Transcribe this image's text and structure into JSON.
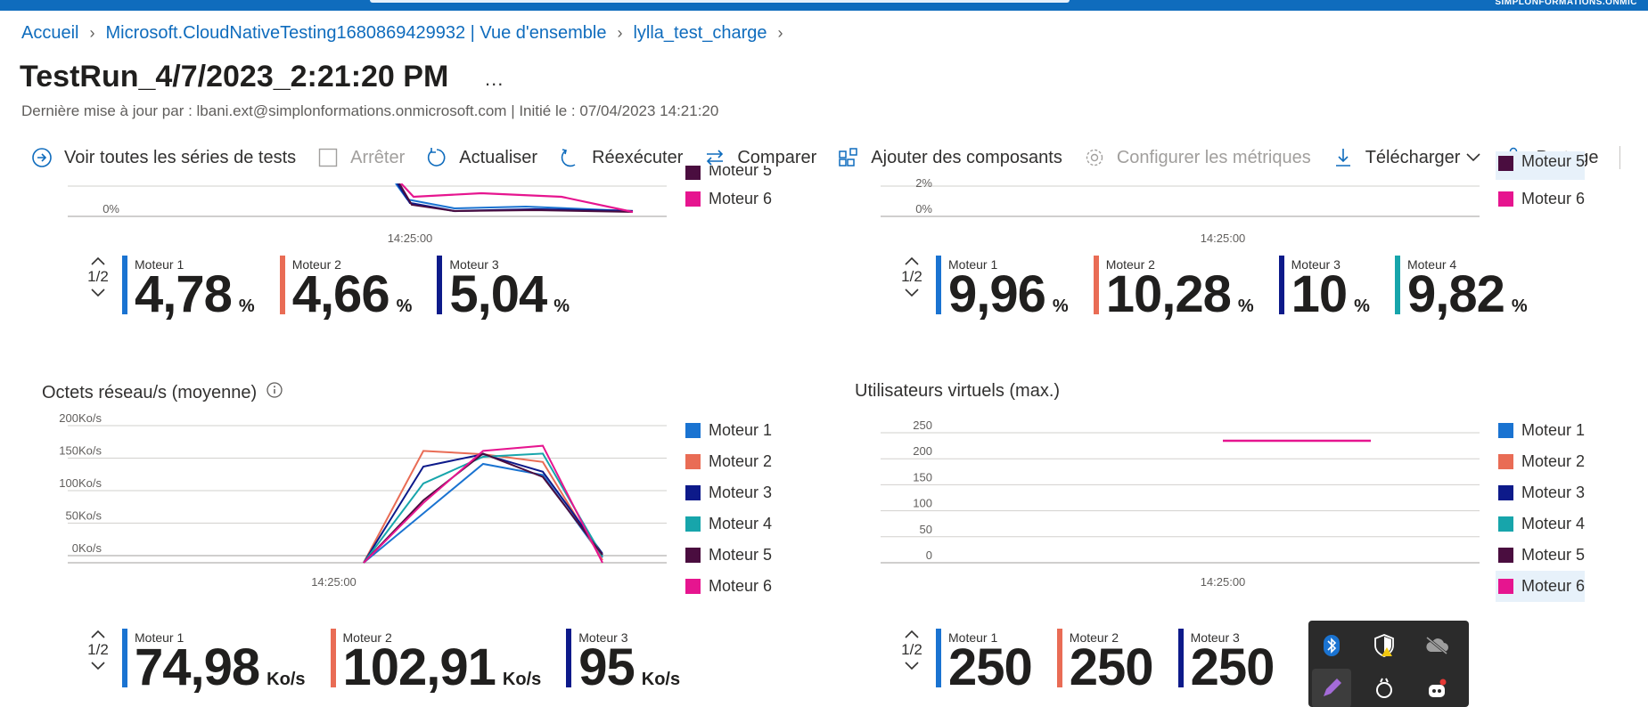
{
  "topbar": {
    "corner_text": "SIMPLONFORMATIONS.ONMIC"
  },
  "breadcrumb": {
    "items": [
      "Accueil",
      "Microsoft.CloudNativeTesting1680869429932 | Vue d'ensemble",
      "lylla_test_charge"
    ],
    "separator": ">"
  },
  "page": {
    "title": "TestRun_4/7/2023_2:21:20 PM",
    "more": "...",
    "subtitle": "Dernière mise à jour par : lbani.ext@simplonformations.onmicrosoft.com | Initié le : 07/04/2023 14:21:20"
  },
  "toolbar": {
    "all_runs": "Voir toutes les séries de tests",
    "stop": "Arrêter",
    "refresh": "Actualiser",
    "rerun": "Réexécuter",
    "compare": "Comparer",
    "add_components": "Ajouter des composants",
    "configure_metrics": "Configurer les métriques",
    "download": "Télécharger",
    "share": "Partage",
    "more": "..."
  },
  "colors": {
    "engine1": "#1a73d1",
    "engine2": "#e96c55",
    "engine3": "#0d1a8a",
    "engine4": "#17a5ab",
    "engine5": "#4a0d3f",
    "engine6": "#e6158f"
  },
  "top_left": {
    "y_tick": "0%",
    "x_tick": "14:25:00",
    "legend": [
      "Moteur 5",
      "Moteur 6"
    ],
    "pager": "1/2",
    "metrics": [
      {
        "label": "Moteur 1",
        "value": "4,78",
        "unit": "%"
      },
      {
        "label": "Moteur 2",
        "value": "4,66",
        "unit": "%"
      },
      {
        "label": "Moteur 3",
        "value": "5,04",
        "unit": "%"
      }
    ]
  },
  "top_right": {
    "y_ticks": [
      "2%",
      "0%"
    ],
    "x_tick": "14:25:00",
    "legend": [
      "Moteur 5",
      "Moteur 6"
    ],
    "pager": "1/2",
    "metrics": [
      {
        "label": "Moteur 1",
        "value": "9,96",
        "unit": "%"
      },
      {
        "label": "Moteur 2",
        "value": "10,28",
        "unit": "%"
      },
      {
        "label": "Moteur 3",
        "value": "10",
        "unit": "%"
      },
      {
        "label": "Moteur 4",
        "value": "9,82",
        "unit": "%"
      }
    ]
  },
  "network": {
    "title": "Octets réseau/s (moyenne)",
    "pager": "1/2",
    "metrics": [
      {
        "label": "Moteur 1",
        "value": "74,98",
        "unit": "Ko/s"
      },
      {
        "label": "Moteur 2",
        "value": "102,91",
        "unit": "Ko/s"
      },
      {
        "label": "Moteur 3",
        "value": "95",
        "unit": "Ko/s"
      }
    ]
  },
  "users": {
    "title": "Utilisateurs virtuels (max.)",
    "pager": "1/2",
    "metrics": [
      {
        "label": "Moteur 1",
        "value": "250",
        "unit": ""
      },
      {
        "label": "Moteur 2",
        "value": "250",
        "unit": ""
      },
      {
        "label": "Moteur 3",
        "value": "250",
        "unit": ""
      }
    ]
  },
  "tray": {
    "icons": [
      "bluetooth-icon",
      "security-warning-icon",
      "cloud-offline-icon",
      "pen-icon",
      "app-icon",
      "bot-icon"
    ]
  },
  "chart_data": [
    {
      "type": "line",
      "title": "Octets réseau/s (moyenne)",
      "x": [
        "t0",
        "t1",
        "t2",
        "t3",
        "t4",
        "t5",
        "t6",
        "t7",
        "t8",
        "t9"
      ],
      "x_tick_labels": [
        "14:25:00"
      ],
      "x_tick_index": 3.5,
      "y_tick_labels": [
        "200Ko/s",
        "150Ko/s",
        "100Ko/s",
        "50Ko/s",
        "0Ko/s"
      ],
      "ylim": [
        0,
        200
      ],
      "y_tick_values": [
        200,
        150,
        100,
        50,
        0
      ],
      "grid": true,
      "legend_position": "right",
      "series": [
        {
          "name": "Moteur 1",
          "values": [
            null,
            null,
            null,
            null,
            0,
            76,
            152,
            135,
            8,
            null
          ]
        },
        {
          "name": "Moteur 2",
          "values": [
            null,
            null,
            null,
            null,
            0,
            172,
            167,
            155,
            4,
            null
          ]
        },
        {
          "name": "Moteur 3",
          "values": [
            null,
            null,
            null,
            null,
            0,
            148,
            167,
            140,
            14,
            null
          ]
        },
        {
          "name": "Moteur 4",
          "values": [
            null,
            null,
            null,
            null,
            0,
            122,
            163,
            168,
            10,
            null
          ]
        },
        {
          "name": "Moteur 5",
          "values": [
            null,
            null,
            null,
            null,
            0,
            96,
            168,
            132,
            12,
            null
          ]
        },
        {
          "name": "Moteur 6",
          "values": [
            null,
            null,
            null,
            null,
            0,
            92,
            172,
            180,
            0,
            null
          ]
        }
      ]
    },
    {
      "type": "line",
      "title": "Utilisateurs virtuels (max.)",
      "x_tick_labels": [
        "14:25:00"
      ],
      "y_tick_labels": [
        "250",
        "200",
        "150",
        "100",
        "50",
        "0"
      ],
      "ylim": [
        0,
        250
      ],
      "grid": true,
      "legend_position": "right",
      "series": [
        {
          "name": "Moteur 1",
          "values": []
        },
        {
          "name": "Moteur 2",
          "values": []
        },
        {
          "name": "Moteur 3",
          "values": []
        },
        {
          "name": "Moteur 4",
          "values": []
        },
        {
          "name": "Moteur 5",
          "values": []
        },
        {
          "name": "Moteur 6",
          "values": [
            250,
            250
          ]
        }
      ]
    }
  ]
}
